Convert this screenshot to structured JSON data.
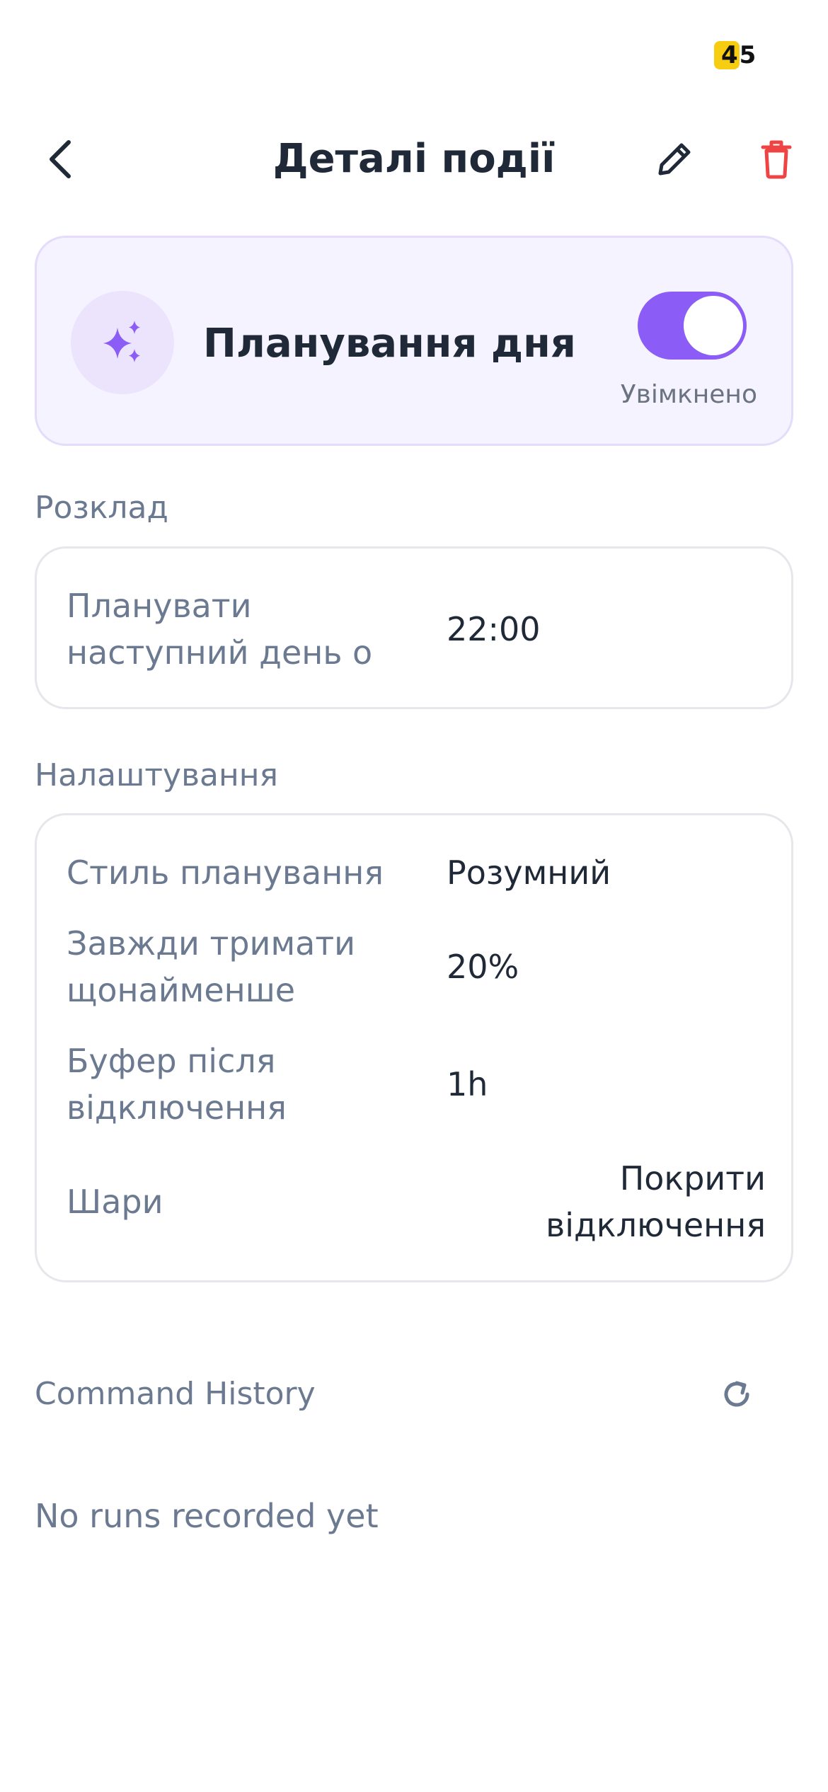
{
  "status_bar": {
    "badge_text_highlight": "4",
    "badge_text_rest": "5",
    "badge_color": "#f7cd12"
  },
  "header": {
    "title": "Деталі події",
    "back_icon": "chevron-left-icon",
    "edit_icon": "pencil-icon",
    "delete_icon": "trash-icon",
    "delete_color": "#ef4444"
  },
  "hero": {
    "icon": "sparkles-icon",
    "title": "Планування дня",
    "toggle_on": true,
    "toggle_status": "Увімкнено",
    "accent_color": "#8b5cf6"
  },
  "schedule": {
    "section_label": "Розклад",
    "rows": [
      {
        "label": "Планувати наступний день о",
        "value": "22:00"
      }
    ]
  },
  "settings": {
    "section_label": "Налаштування",
    "rows": [
      {
        "label": "Стиль планування",
        "value": "Розумний"
      },
      {
        "label": "Завжди тримати щонайменше",
        "value": "20%"
      },
      {
        "label": "Буфер після відключення",
        "value": "1h"
      },
      {
        "label": "Шари",
        "value": "Покрити відключення"
      }
    ]
  },
  "history": {
    "title": "Command History",
    "refresh_icon": "refresh-icon",
    "empty_text": "No runs recorded yet"
  }
}
